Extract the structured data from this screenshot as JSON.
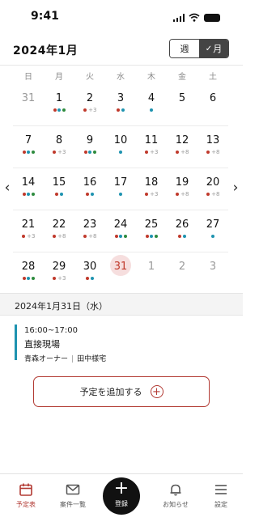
{
  "status": {
    "time": "9:41"
  },
  "header": {
    "month": "2024年1月",
    "week_label": "週",
    "month_label": "月"
  },
  "weekdays": [
    "日",
    "月",
    "火",
    "水",
    "木",
    "金",
    "土"
  ],
  "colors": {
    "accent": "#b23a33",
    "red": "#c0392b",
    "teal": "#1e93b0",
    "green": "#2e8b3e",
    "today_bg": "#f6dede"
  },
  "days": [
    {
      "label": "31",
      "other": true,
      "dots": []
    },
    {
      "label": "1",
      "dots": [
        "red",
        "teal",
        "green"
      ]
    },
    {
      "label": "2",
      "dots": [
        "red"
      ],
      "more": "+3"
    },
    {
      "label": "3",
      "dots": [
        "red",
        "teal"
      ]
    },
    {
      "label": "4",
      "dots": [
        "teal"
      ]
    },
    {
      "label": "5",
      "dots": []
    },
    {
      "label": "6",
      "dots": []
    },
    {
      "label": "7",
      "dots": [
        "red",
        "teal",
        "green"
      ]
    },
    {
      "label": "8",
      "dots": [
        "red"
      ],
      "more": "+3"
    },
    {
      "label": "9",
      "dots": [
        "red",
        "teal",
        "green"
      ]
    },
    {
      "label": "10",
      "dots": [
        "teal"
      ]
    },
    {
      "label": "11",
      "dots": [
        "red"
      ],
      "more": "+3"
    },
    {
      "label": "12",
      "dots": [
        "red"
      ],
      "more": "+8"
    },
    {
      "label": "13",
      "dots": [
        "red"
      ],
      "more": "+8"
    },
    {
      "label": "14",
      "dots": [
        "red",
        "teal",
        "green"
      ]
    },
    {
      "label": "15",
      "dots": [
        "red",
        "teal"
      ]
    },
    {
      "label": "16",
      "dots": [
        "red",
        "teal"
      ]
    },
    {
      "label": "17",
      "dots": [
        "teal"
      ]
    },
    {
      "label": "18",
      "dots": [
        "red"
      ],
      "more": "+3"
    },
    {
      "label": "19",
      "dots": [
        "red"
      ],
      "more": "+8"
    },
    {
      "label": "20",
      "dots": [
        "red"
      ],
      "more": "+8"
    },
    {
      "label": "21",
      "dots": [
        "red"
      ],
      "more": "+3"
    },
    {
      "label": "22",
      "dots": [
        "red"
      ],
      "more": "+8"
    },
    {
      "label": "23",
      "dots": [
        "red"
      ],
      "more": "+8"
    },
    {
      "label": "24",
      "dots": [
        "red",
        "teal",
        "green"
      ]
    },
    {
      "label": "25",
      "dots": [
        "red",
        "teal",
        "green"
      ]
    },
    {
      "label": "26",
      "dots": [
        "red",
        "teal"
      ]
    },
    {
      "label": "27",
      "dots": [
        "teal"
      ]
    },
    {
      "label": "28",
      "dots": [
        "red",
        "teal",
        "green"
      ]
    },
    {
      "label": "29",
      "dots": [
        "red"
      ],
      "more": "+3"
    },
    {
      "label": "30",
      "dots": [
        "red",
        "teal"
      ]
    },
    {
      "label": "31",
      "today": true,
      "dots": []
    },
    {
      "label": "1",
      "other": true,
      "dots": []
    },
    {
      "label": "2",
      "other": true,
      "dots": []
    },
    {
      "label": "3",
      "other": true,
      "dots": []
    }
  ],
  "selected_date": "2024年1月31日（水）",
  "event": {
    "time": "16:00~17:00",
    "title": "直接現場",
    "owner": "青森オーナー",
    "staff": "田中様宅"
  },
  "add_button": {
    "label": "予定を追加する"
  },
  "tabs": {
    "schedule": "予定表",
    "cases": "案件一覧",
    "register": "登録",
    "notices": "お知らせ",
    "settings": "設定"
  }
}
